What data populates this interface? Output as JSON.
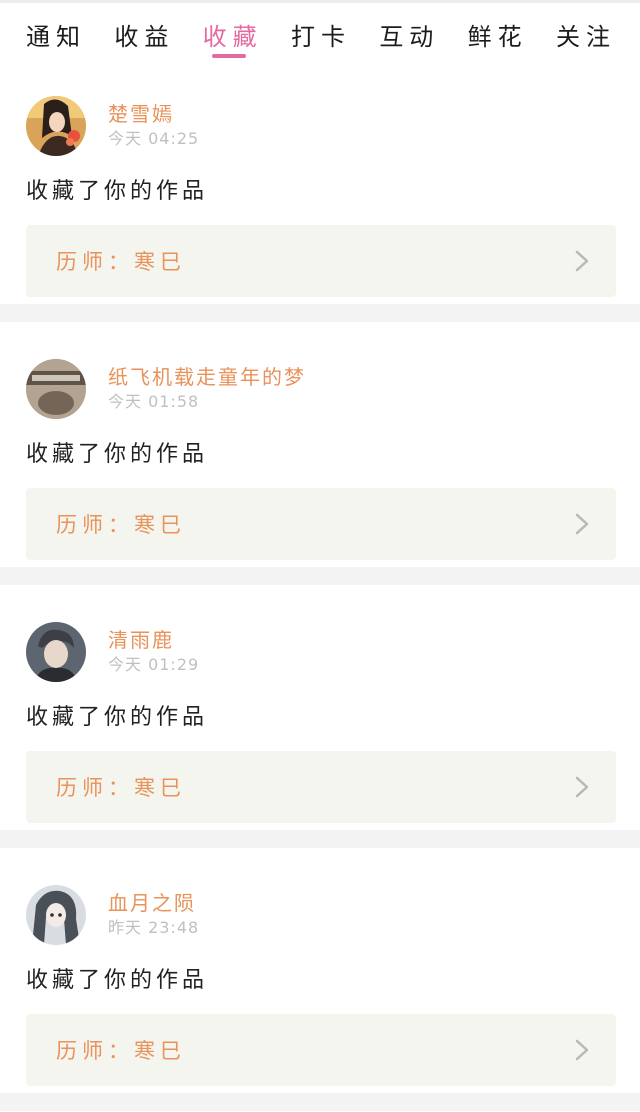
{
  "tabs": [
    {
      "label": "通知",
      "active": false
    },
    {
      "label": "收益",
      "active": false
    },
    {
      "label": "收藏",
      "active": true
    },
    {
      "label": "打卡",
      "active": false
    },
    {
      "label": "互动",
      "active": false
    },
    {
      "label": "鲜花",
      "active": false
    },
    {
      "label": "关注",
      "active": false
    }
  ],
  "notifications": [
    {
      "username": "楚雪嫣",
      "time": "今天 04:25",
      "action": "收藏了你的作品",
      "work_text": "历师：寒巳",
      "avatar_icon": "avatar-woman-flower"
    },
    {
      "username": "纸飞机载走童年的梦",
      "time": "今天 01:58",
      "action": "收藏了你的作品",
      "work_text": "历师：寒巳",
      "avatar_icon": "avatar-tfboys"
    },
    {
      "username": "清雨鹿",
      "time": "今天 01:29",
      "action": "收藏了你的作品",
      "work_text": "历师：寒巳",
      "avatar_icon": "avatar-boy"
    },
    {
      "username": "血月之陨",
      "time": "昨天 23:48",
      "action": "收藏了你的作品",
      "work_text": "历师：寒巳",
      "avatar_icon": "avatar-anime-girl"
    }
  ],
  "colors": {
    "accent": "#e46aa2",
    "username": "#e9925a",
    "work_text": "#e9925a",
    "work_bg": "#f5f5ef"
  }
}
